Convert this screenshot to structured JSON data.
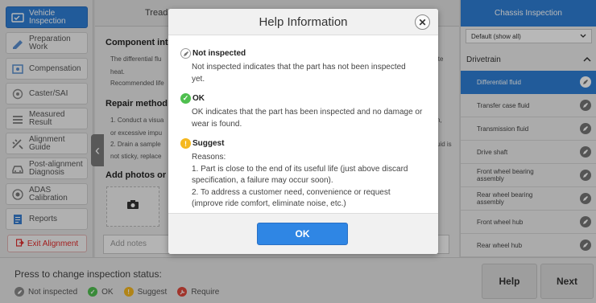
{
  "sidebar": {
    "items": [
      {
        "label": "Vehicle\nInspection",
        "icon": "vehicle-inspection-icon",
        "active": true
      },
      {
        "label": "Preparation\nWork",
        "icon": "preparation-icon",
        "active": false
      },
      {
        "label": "Compensation",
        "icon": "compensation-icon",
        "active": false
      },
      {
        "label": "Caster/SAI",
        "icon": "caster-icon",
        "active": false
      },
      {
        "label": "Measured\nResult",
        "icon": "measured-result-icon",
        "active": false
      },
      {
        "label": "Alignment\nGuide",
        "icon": "alignment-guide-icon",
        "active": false
      },
      {
        "label": "Post-alignment\nDiagnosis",
        "icon": "car-icon",
        "active": false
      },
      {
        "label": "ADAS\nCalibration",
        "icon": "adas-icon",
        "active": false
      },
      {
        "label": "Reports",
        "icon": "reports-icon",
        "active": false
      }
    ],
    "exit_label": "Exit Alignment"
  },
  "main": {
    "tab_label": "Tread",
    "section_component": "Component intr",
    "component_line1": "The differential flu",
    "component_line2": "heat.",
    "component_line3": "Recommended life",
    "right_fragment1": "ite",
    "section_repair": "Repair method",
    "repair_line1": "1. Conduct a visua",
    "repair_line2": "or excessive impu",
    "repair_line3": "2. Drain a sample",
    "repair_line4": "not sticky, replace",
    "right_fragment2": "n,",
    "right_fragment3": "uid is",
    "section_photos": "Add photos or",
    "notes_placeholder": "Add notes"
  },
  "right_panel": {
    "title": "Chassis Inspection",
    "filter_value": "Default (show all)",
    "group_label": "Drivetrain",
    "items": [
      {
        "label": "Differential fluid",
        "selected": true
      },
      {
        "label": "Transfer case fluid",
        "selected": false
      },
      {
        "label": "Transmission fluid",
        "selected": false
      },
      {
        "label": "Drive shaft",
        "selected": false
      },
      {
        "label": "Front wheel bearing\nassembly",
        "selected": false
      },
      {
        "label": "Rear wheel bearing\nassembly",
        "selected": false
      },
      {
        "label": "Front wheel hub",
        "selected": false
      },
      {
        "label": "Rear wheel hub",
        "selected": false
      }
    ]
  },
  "bottom": {
    "press_text": "Press to change inspection status:",
    "legend": [
      {
        "label": "Not inspected",
        "color": "#8a8a8a"
      },
      {
        "label": "OK",
        "color": "#4fbf4f"
      },
      {
        "label": "Suggest",
        "color": "#f5b820"
      },
      {
        "label": "Require",
        "color": "#e0493c"
      }
    ],
    "help_label": "Help",
    "next_label": "Next"
  },
  "modal": {
    "title": "Help Information",
    "close_symbol": "✕",
    "entries": [
      {
        "title": "Not inspected",
        "icon": "pen-icon",
        "color": "#8a8a8a",
        "lines": [
          "Not inspected indicates that the part has not been inspected",
          "yet."
        ]
      },
      {
        "title": "OK",
        "icon": "check-icon",
        "color": "#4fbf4f",
        "lines": [
          "OK indicates that the part has been inspected and no damage or",
          "wear is found."
        ]
      },
      {
        "title": "Suggest",
        "icon": "exclamation-icon",
        "color": "#f5b820",
        "lines": [
          "Reasons:",
          "1. Part is close to the end of its useful life (just above discard",
          "specification, a failure may occur soon).",
          "2. To address a customer need, convenience or request",
          "(improve ride comfort, eliminate noise, etc.)"
        ]
      }
    ],
    "ok_label": "OK"
  }
}
